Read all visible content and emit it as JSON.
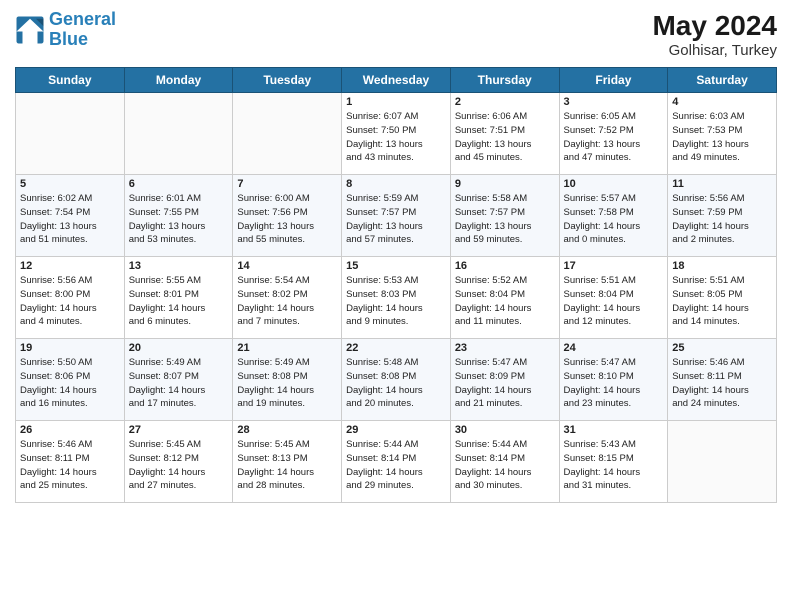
{
  "logo": {
    "line1": "General",
    "line2": "Blue"
  },
  "title": {
    "month_year": "May 2024",
    "location": "Golhisar, Turkey"
  },
  "weekdays": [
    "Sunday",
    "Monday",
    "Tuesday",
    "Wednesday",
    "Thursday",
    "Friday",
    "Saturday"
  ],
  "weeks": [
    [
      {
        "day": "",
        "text": ""
      },
      {
        "day": "",
        "text": ""
      },
      {
        "day": "",
        "text": ""
      },
      {
        "day": "1",
        "text": "Sunrise: 6:07 AM\nSunset: 7:50 PM\nDaylight: 13 hours\nand 43 minutes."
      },
      {
        "day": "2",
        "text": "Sunrise: 6:06 AM\nSunset: 7:51 PM\nDaylight: 13 hours\nand 45 minutes."
      },
      {
        "day": "3",
        "text": "Sunrise: 6:05 AM\nSunset: 7:52 PM\nDaylight: 13 hours\nand 47 minutes."
      },
      {
        "day": "4",
        "text": "Sunrise: 6:03 AM\nSunset: 7:53 PM\nDaylight: 13 hours\nand 49 minutes."
      }
    ],
    [
      {
        "day": "5",
        "text": "Sunrise: 6:02 AM\nSunset: 7:54 PM\nDaylight: 13 hours\nand 51 minutes."
      },
      {
        "day": "6",
        "text": "Sunrise: 6:01 AM\nSunset: 7:55 PM\nDaylight: 13 hours\nand 53 minutes."
      },
      {
        "day": "7",
        "text": "Sunrise: 6:00 AM\nSunset: 7:56 PM\nDaylight: 13 hours\nand 55 minutes."
      },
      {
        "day": "8",
        "text": "Sunrise: 5:59 AM\nSunset: 7:57 PM\nDaylight: 13 hours\nand 57 minutes."
      },
      {
        "day": "9",
        "text": "Sunrise: 5:58 AM\nSunset: 7:57 PM\nDaylight: 13 hours\nand 59 minutes."
      },
      {
        "day": "10",
        "text": "Sunrise: 5:57 AM\nSunset: 7:58 PM\nDaylight: 14 hours\nand 0 minutes."
      },
      {
        "day": "11",
        "text": "Sunrise: 5:56 AM\nSunset: 7:59 PM\nDaylight: 14 hours\nand 2 minutes."
      }
    ],
    [
      {
        "day": "12",
        "text": "Sunrise: 5:56 AM\nSunset: 8:00 PM\nDaylight: 14 hours\nand 4 minutes."
      },
      {
        "day": "13",
        "text": "Sunrise: 5:55 AM\nSunset: 8:01 PM\nDaylight: 14 hours\nand 6 minutes."
      },
      {
        "day": "14",
        "text": "Sunrise: 5:54 AM\nSunset: 8:02 PM\nDaylight: 14 hours\nand 7 minutes."
      },
      {
        "day": "15",
        "text": "Sunrise: 5:53 AM\nSunset: 8:03 PM\nDaylight: 14 hours\nand 9 minutes."
      },
      {
        "day": "16",
        "text": "Sunrise: 5:52 AM\nSunset: 8:04 PM\nDaylight: 14 hours\nand 11 minutes."
      },
      {
        "day": "17",
        "text": "Sunrise: 5:51 AM\nSunset: 8:04 PM\nDaylight: 14 hours\nand 12 minutes."
      },
      {
        "day": "18",
        "text": "Sunrise: 5:51 AM\nSunset: 8:05 PM\nDaylight: 14 hours\nand 14 minutes."
      }
    ],
    [
      {
        "day": "19",
        "text": "Sunrise: 5:50 AM\nSunset: 8:06 PM\nDaylight: 14 hours\nand 16 minutes."
      },
      {
        "day": "20",
        "text": "Sunrise: 5:49 AM\nSunset: 8:07 PM\nDaylight: 14 hours\nand 17 minutes."
      },
      {
        "day": "21",
        "text": "Sunrise: 5:49 AM\nSunset: 8:08 PM\nDaylight: 14 hours\nand 19 minutes."
      },
      {
        "day": "22",
        "text": "Sunrise: 5:48 AM\nSunset: 8:08 PM\nDaylight: 14 hours\nand 20 minutes."
      },
      {
        "day": "23",
        "text": "Sunrise: 5:47 AM\nSunset: 8:09 PM\nDaylight: 14 hours\nand 21 minutes."
      },
      {
        "day": "24",
        "text": "Sunrise: 5:47 AM\nSunset: 8:10 PM\nDaylight: 14 hours\nand 23 minutes."
      },
      {
        "day": "25",
        "text": "Sunrise: 5:46 AM\nSunset: 8:11 PM\nDaylight: 14 hours\nand 24 minutes."
      }
    ],
    [
      {
        "day": "26",
        "text": "Sunrise: 5:46 AM\nSunset: 8:11 PM\nDaylight: 14 hours\nand 25 minutes."
      },
      {
        "day": "27",
        "text": "Sunrise: 5:45 AM\nSunset: 8:12 PM\nDaylight: 14 hours\nand 27 minutes."
      },
      {
        "day": "28",
        "text": "Sunrise: 5:45 AM\nSunset: 8:13 PM\nDaylight: 14 hours\nand 28 minutes."
      },
      {
        "day": "29",
        "text": "Sunrise: 5:44 AM\nSunset: 8:14 PM\nDaylight: 14 hours\nand 29 minutes."
      },
      {
        "day": "30",
        "text": "Sunrise: 5:44 AM\nSunset: 8:14 PM\nDaylight: 14 hours\nand 30 minutes."
      },
      {
        "day": "31",
        "text": "Sunrise: 5:43 AM\nSunset: 8:15 PM\nDaylight: 14 hours\nand 31 minutes."
      },
      {
        "day": "",
        "text": ""
      }
    ]
  ]
}
